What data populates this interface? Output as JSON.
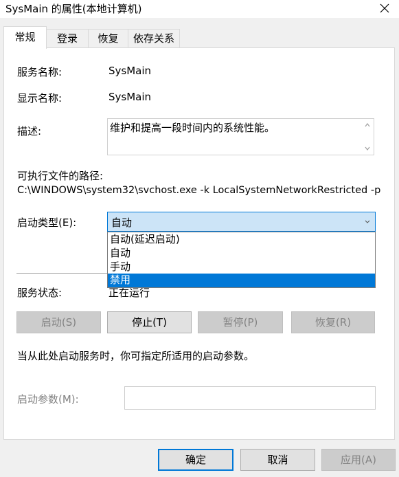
{
  "window": {
    "title": "SysMain 的属性(本地计算机)"
  },
  "tabs": [
    {
      "label": "常规"
    },
    {
      "label": "登录"
    },
    {
      "label": "恢复"
    },
    {
      "label": "依存关系"
    }
  ],
  "general": {
    "service_name_label": "服务名称:",
    "service_name": "SysMain",
    "display_name_label": "显示名称:",
    "display_name": "SysMain",
    "description_label": "描述:",
    "description": "维护和提高一段时间内的系统性能。",
    "exe_path_label": "可执行文件的路径:",
    "exe_path": "C:\\WINDOWS\\system32\\svchost.exe -k LocalSystemNetworkRestricted -p",
    "startup_type_label": "启动类型(E):",
    "startup_type_value": "自动",
    "startup_options": [
      "自动(延迟启动)",
      "自动",
      "手动",
      "禁用"
    ],
    "service_status_label": "服务状态:",
    "service_status": "正在运行",
    "buttons": {
      "start": "启动(S)",
      "stop": "停止(T)",
      "pause": "暂停(P)",
      "resume": "恢复(R)"
    },
    "hint": "当从此处启动服务时，你可指定所适用的启动参数。",
    "start_params_label": "启动参数(M):",
    "start_params_value": ""
  },
  "dialog_buttons": {
    "ok": "确定",
    "cancel": "取消",
    "apply": "应用(A)"
  },
  "colors": {
    "accent": "#0078d7",
    "select_bg": "#cce4f7",
    "disabled_text": "#838383"
  }
}
